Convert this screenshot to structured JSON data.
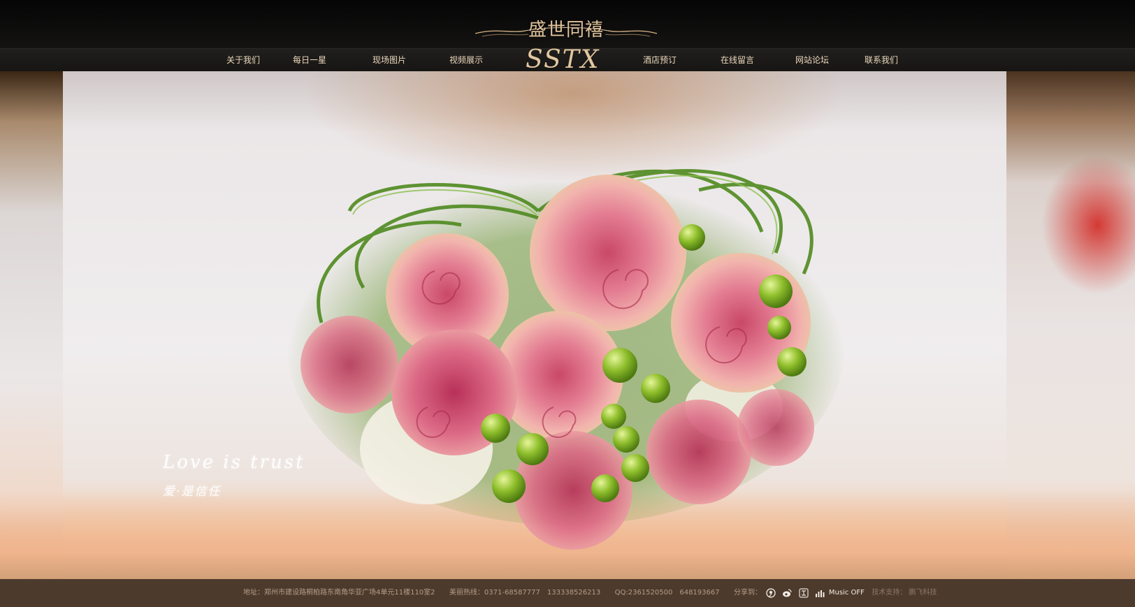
{
  "header": {
    "brand_cn": "盛世同禧",
    "brand_logo": "SSTX"
  },
  "nav": {
    "items": [
      "关于我们",
      "每日一星",
      "现场图片",
      "视频展示",
      "酒店预订",
      "在线留言",
      "网站论坛",
      "联系我们"
    ]
  },
  "hero": {
    "slogan_en": "Love is trust",
    "slogan_cn": "爱·是信任"
  },
  "footer": {
    "address": "地址：郑州市建设路桐柏路东南角华亚广场4单元11楼110室2",
    "hotline": "美丽热线：0371-68587777　133338526213",
    "qq": "QQ:2361520500　648193667",
    "share_label": "分享到：",
    "share_icons": [
      "qq-weibo-icon",
      "sina-weibo-icon",
      "renren-icon"
    ],
    "music_label": "Music OFF",
    "tech_label": "技术支持：",
    "tech_name": "鹏飞科技"
  },
  "colors": {
    "header_bg": "#0d0c0b",
    "nav_text": "#ecd9bd",
    "brand_gold": "#e0c39b",
    "footer_bg": "#4c3a2d",
    "footer_text": "#b49d86"
  }
}
